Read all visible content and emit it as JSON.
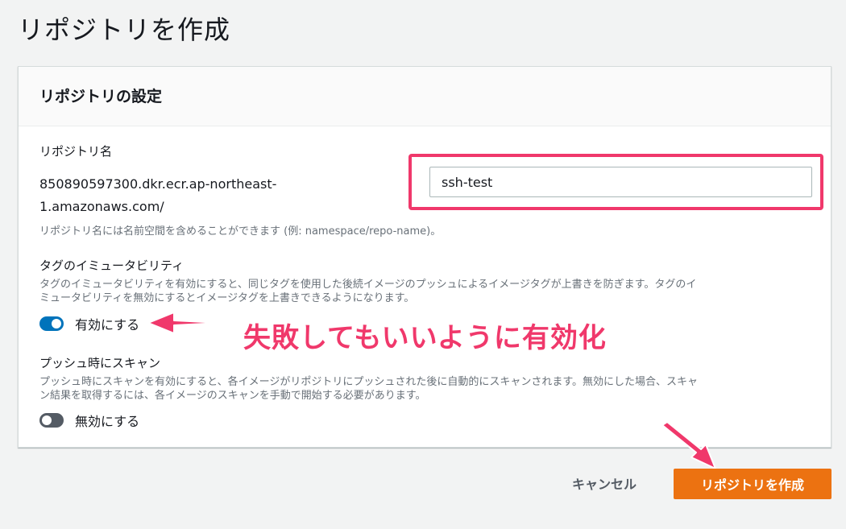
{
  "page": {
    "title": "リポジトリを作成"
  },
  "panel": {
    "title": "リポジトリの設定",
    "repo_name": {
      "label": "リポジトリ名",
      "prefix_line1": "850890597300.dkr.ecr.ap-northeast-",
      "prefix_line2": "1.amazonaws.com/",
      "value": "ssh-test",
      "hint": "リポジトリ名には名前空間を含めることができます (例: namespace/repo-name)。"
    },
    "immutability": {
      "title": "タグのイミュータビリティ",
      "desc_line1": "タグのイミュータビリティを有効にすると、同じタグを使用した後続イメージのプッシュによるイメージタグが上書きを防ぎます。タグのイ",
      "desc_line2": "ミュータビリティを無効にするとイメージタグを上書きできるようになります。",
      "toggle_label": "有効にする",
      "enabled": true
    },
    "scan": {
      "title": "プッシュ時にスキャン",
      "desc_line1": "プッシュ時にスキャンを有効にすると、各イメージがリポジトリにプッシュされた後に自動的にスキャンされます。無効にした場合、スキャ",
      "desc_line2": "ン結果を取得するには、各イメージのスキャンを手動で開始する必要があります。",
      "toggle_label": "無効にする",
      "enabled": false
    }
  },
  "annotation": {
    "text": "失敗してもいいように有効化",
    "color": "#f0386b"
  },
  "actions": {
    "cancel_label": "キャンセル",
    "create_label": "リポジトリを作成"
  },
  "colors": {
    "accent": "#0073bb",
    "primary_button": "#ec7211",
    "annotation": "#f0386b"
  }
}
